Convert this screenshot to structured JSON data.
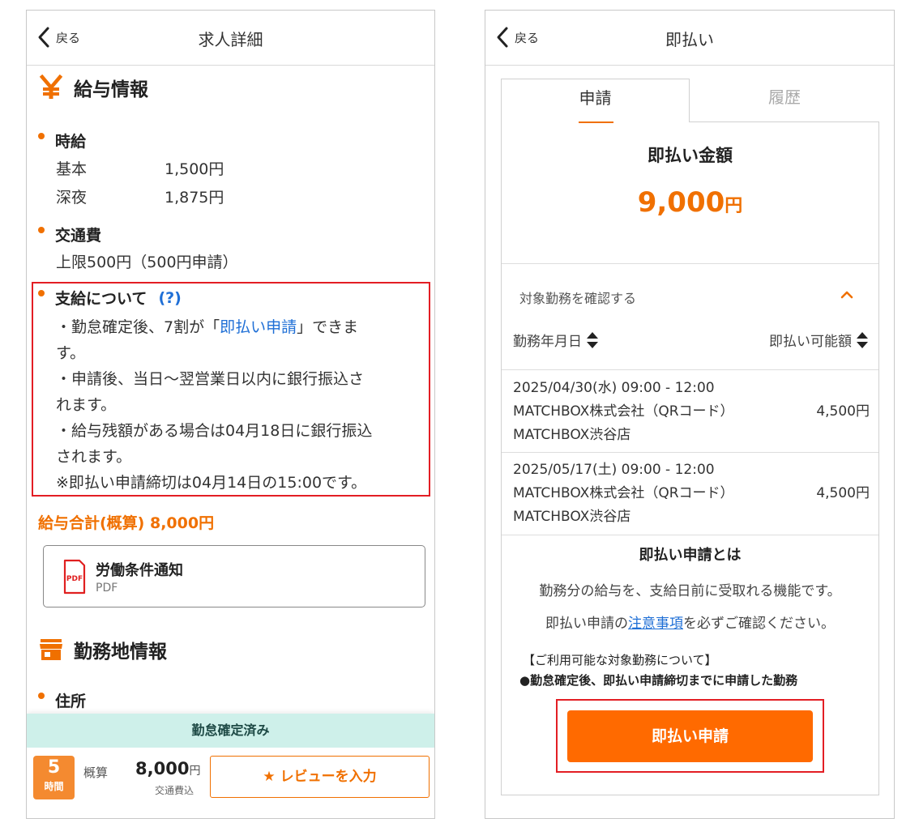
{
  "left": {
    "back_label": "戻る",
    "title": "求人詳細",
    "salary_section": "給与情報",
    "hourly": {
      "heading": "時給",
      "rows": [
        {
          "label": "基本",
          "value": "1,500円"
        },
        {
          "label": "深夜",
          "value": "1,875円"
        }
      ]
    },
    "transport": {
      "heading": "交通費",
      "value": "上限500円（500円申請）"
    },
    "payment": {
      "heading": "支給について",
      "help": "(?)",
      "line1_pre": "・勤怠確定後、7割が「",
      "line1_link": "即払い申請",
      "line1_post": "」できま",
      "line1_cont": "す。",
      "line2a": "・申請後、当日〜翌営業日以内に銀行振込さ",
      "line2b": "れます。",
      "line3a": "・給与残額がある場合は04月18日に銀行振込",
      "line3b": "されます。",
      "line4": "※即払い申請締切は04月14日の15:00です。"
    },
    "total": "給与合計(概算) 8,000円",
    "pdf": {
      "name": "労働条件通知",
      "type": "PDF",
      "icon_label": "PDF"
    },
    "workplace_section": "勤務地情報",
    "address_heading": "住所",
    "bottom": {
      "status": "勤怠確定済み",
      "hours_num": "5",
      "hours_unit": "時間",
      "estimate_label": "概算",
      "estimate_amount": "8,000",
      "estimate_unit": "円",
      "estimate_sub": "交通費込",
      "review_button": "★ レビューを入力"
    }
  },
  "right": {
    "back_label": "戻る",
    "title": "即払い",
    "tabs": [
      {
        "label": "申請"
      },
      {
        "label": "履歴"
      }
    ],
    "amount_title": "即払い金額",
    "amount_value": "9,000",
    "amount_unit": "円",
    "confirm_label": "対象勤務を確認する",
    "col_date": "勤務年月日",
    "col_amount": "即払い可能額",
    "work_items": [
      {
        "datetime": "2025/04/30(水) 09:00 - 12:00",
        "company": "MATCHBOX株式会社（QRコード）",
        "store": "MATCHBOX渋谷店",
        "amount": "4,500円"
      },
      {
        "datetime": "2025/05/17(土) 09:00 - 12:00",
        "company": "MATCHBOX株式会社（QRコード）",
        "store": "MATCHBOX渋谷店",
        "amount": "4,500円"
      }
    ],
    "what_title": "即払い申請とは",
    "what_desc": "勤務分の給与を、支給日前に受取れる機能です。",
    "note_pre": "即払い申請の",
    "note_link": "注意事項",
    "note_post": "を必ずご確認ください。",
    "cond_heading": "【ご利用可能な対象勤務について】",
    "cond_body": "●勤怠確定後、即払い申請締切までに申請した勤務",
    "apply_button": "即払い申請"
  },
  "colors": {
    "accent": "#f07000",
    "link": "#1f6fd6",
    "highlight": "#e31e24",
    "status_band": "#cef0ea"
  }
}
